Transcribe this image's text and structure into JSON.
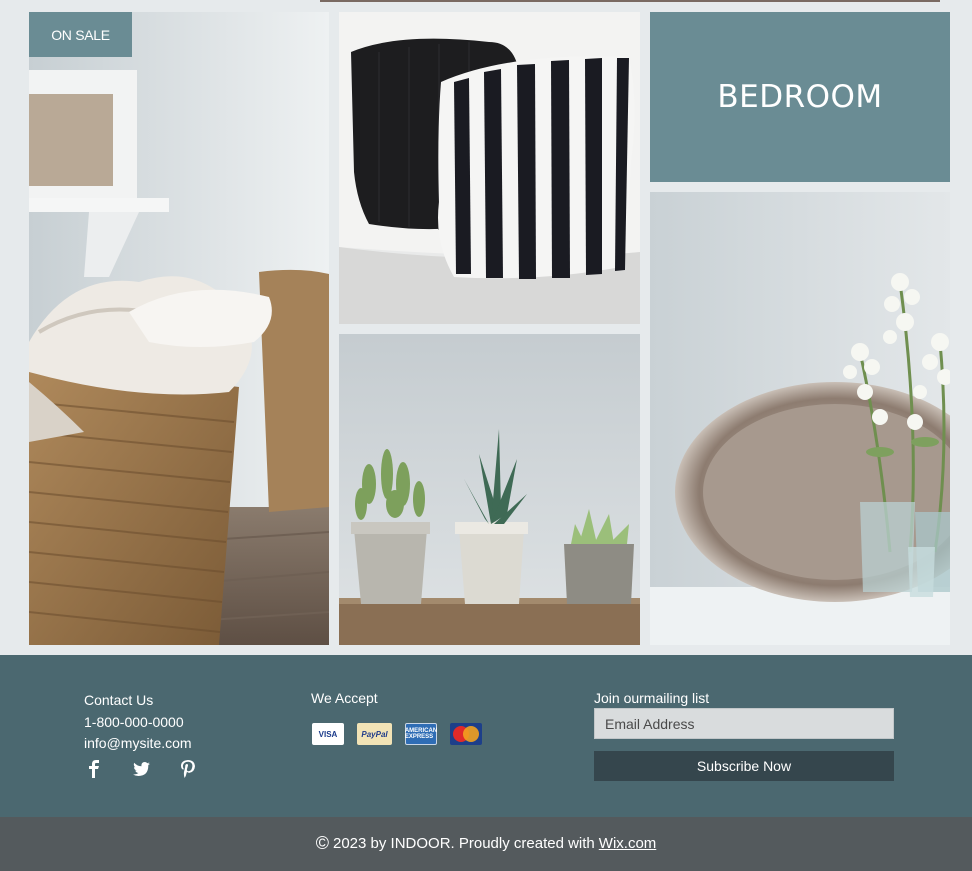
{
  "gallery": {
    "badge": "ON SALE",
    "category_title": "BEDROOM",
    "tiles": [
      {
        "subject": "towels-basket-photo"
      },
      {
        "subject": "striped-pillows-photo"
      },
      {
        "subject": "succulent-plants-photo"
      },
      {
        "subject": "white-flowers-photo"
      }
    ]
  },
  "footer": {
    "contact": {
      "heading": "Contact Us",
      "phone": "1-800-000-0000",
      "email": "info@mysite.com"
    },
    "social": [
      {
        "icon": "facebook-icon"
      },
      {
        "icon": "twitter-icon"
      },
      {
        "icon": "pinterest-icon"
      }
    ],
    "payments": {
      "heading": "We Accept",
      "cards": [
        {
          "icon": "visa-icon",
          "text": "VISA"
        },
        {
          "icon": "paypal-icon",
          "text": "PayPal"
        },
        {
          "icon": "amex-icon",
          "text": "AMERICAN EXPRESS"
        },
        {
          "icon": "mastercard-icon",
          "text": "MasterCard"
        }
      ]
    },
    "newsletter": {
      "heading": "Join ourmailing list",
      "placeholder": "Email Address",
      "value": "",
      "button": "Subscribe Now"
    },
    "copyright": {
      "symbol": "©",
      "text": "2023 by INDOOR. Proudly created with",
      "link": "Wix.com"
    }
  },
  "colors": {
    "accent": "#6a8c94",
    "footer_bg": "#4b6870",
    "button_bg": "#35464d",
    "bottom_bar_bg": "#545a5d"
  }
}
